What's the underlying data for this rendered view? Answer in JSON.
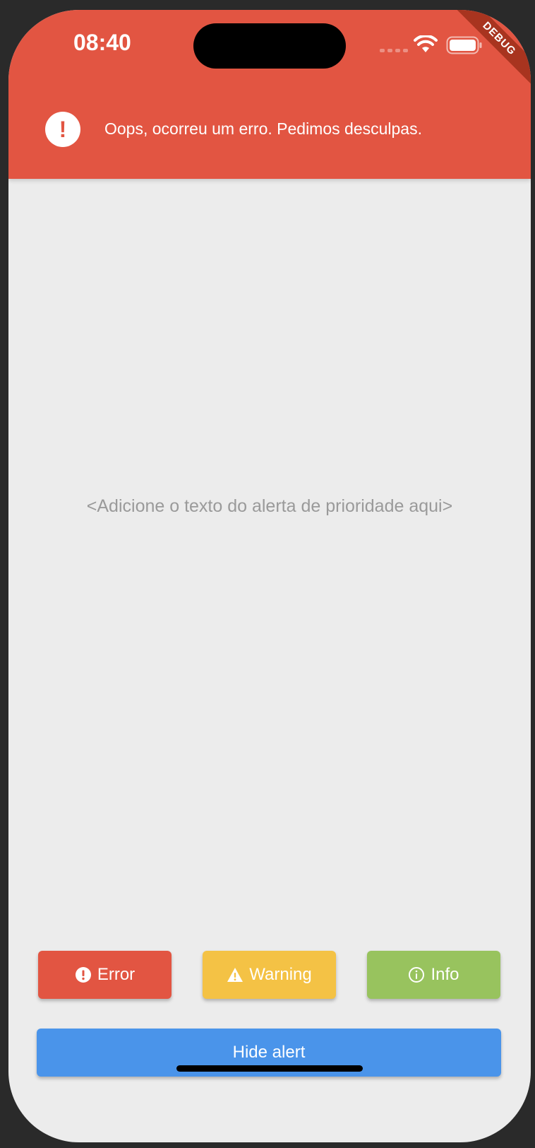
{
  "status_bar": {
    "time": "08:40"
  },
  "debug_banner": "DEBUG",
  "alert": {
    "message": "Oops, ocorreu um erro. Pedimos desculpas.",
    "icon": "error-circle-icon"
  },
  "main": {
    "placeholder": "<Adicione o texto do alerta de prioridade aqui>"
  },
  "buttons": {
    "error": "Error",
    "warning": "Warning",
    "info": "Info",
    "hide": "Hide alert"
  },
  "colors": {
    "error": "#e25542",
    "warning": "#f4c245",
    "info": "#98c35e",
    "primary": "#4a94ea",
    "background": "#ececec"
  }
}
